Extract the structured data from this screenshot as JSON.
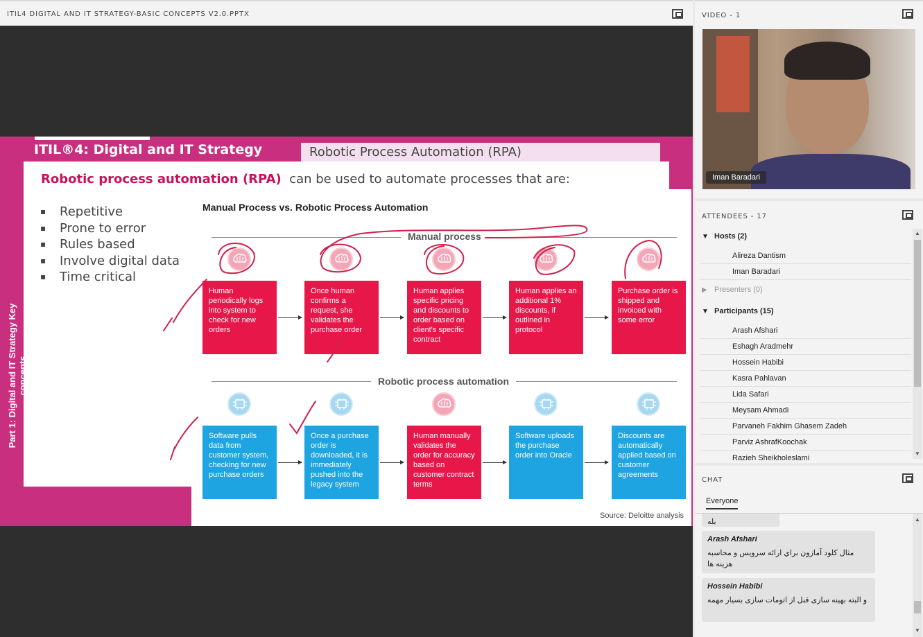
{
  "share": {
    "title": "ITIL4 DIGITAL AND IT STRATEGY-BASIC CONCEPTS V2.0.PPTX"
  },
  "slide": {
    "itil_title": "ITIL®4: Digital and IT Strategy",
    "header_box": "Robotic Process Automation (RPA)",
    "lead_bold": "Robotic process automation (RPA)",
    "lead_rest": "can be used to automate processes that are:",
    "bullets": [
      "Repetitive",
      "Prone to error",
      "Rules based",
      "Involve digital data",
      "Time critical"
    ],
    "side_label": "Part 1: Digital and IT Strategy Key concepts",
    "figure_title": "Manual Process vs. Robotic Process Automation",
    "manual_title": "Manual process",
    "rpa_title": "Robotic process automation",
    "manual_steps": [
      "Human periodically logs into system to check for new orders",
      "Once human confirms a request, she validates the purchase order",
      "Human applies specific pricing and discounts to order based on client's specific contract",
      "Human applies an additional 1% discounts, if outlined in protocol",
      "Purchase order is shipped and invoiced with some error"
    ],
    "rpa_steps": [
      {
        "text": "Software pulls data from customer system, checking for new purchase orders",
        "color": "#1ea4e0",
        "icon": "circuit-icon"
      },
      {
        "text": "Once a purchase order is downloaded, it is immediately pushed into the legacy system",
        "color": "#1ea4e0",
        "icon": "circuit-icon"
      },
      {
        "text": "Human manually validates the order for accuracy based on customer contract terms",
        "color": "#e8174a",
        "icon": "brain-icon"
      },
      {
        "text": "Software uploads the purchase order into Oracle",
        "color": "#1ea4e0",
        "icon": "circuit-icon"
      },
      {
        "text": "Discounts are automatically applied based on customer agreements",
        "color": "#1ea4e0",
        "icon": "circuit-icon"
      }
    ],
    "source": "Source: Deloitte analysis"
  },
  "video": {
    "title": "VIDEO - 1",
    "name": "Iman Baradari"
  },
  "attendees": {
    "title": "ATTENDEES - 17",
    "hosts_label": "Hosts (2)",
    "hosts": [
      "Alireza Dantism",
      "Iman Baradari"
    ],
    "presenters_label": "Presenters (0)",
    "participants_label": "Participants (15)",
    "participants": [
      "Arash Afshari",
      "Eshagh Aradmehr",
      "Hossein Habibi",
      "Kasra Pahlavan",
      "Lida Safari",
      "Meysam Ahmadi",
      "Parvaneh Fakhim Ghasem Zadeh",
      "Parviz AshrafKoochak",
      "Razieh Sheikholeslami"
    ]
  },
  "chat": {
    "title": "CHAT",
    "tab": "Everyone",
    "partial_text": "بله",
    "messages": [
      {
        "who": "Arash Afshari",
        "text": "مثال کلود آمازون براي ارائه سرويس و محاسبه هزينه ها"
      },
      {
        "who": "Hossein Habibi",
        "text": "و البته بهینه سازی قبل از اتومات سازی بسیار مهمه"
      }
    ]
  },
  "colors": {
    "accent_magenta": "#c8307f",
    "manual_red": "#e8174a",
    "rpa_blue": "#1ea4e0",
    "annotation": "#d0204a"
  }
}
